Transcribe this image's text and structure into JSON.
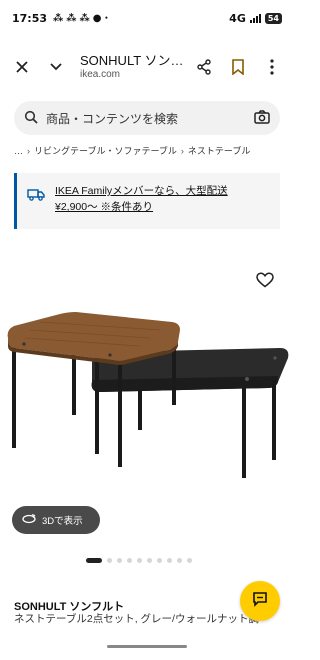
{
  "status_bar": {
    "time": "17:53",
    "network": "4G",
    "battery": "54"
  },
  "browser": {
    "page_title": "SONHULT ソン…",
    "url": "ikea.com"
  },
  "search": {
    "placeholder": "商品・コンテンツを検索"
  },
  "breadcrumb": {
    "ellipsis": "…",
    "items": [
      "リビングテーブル・ソファテーブル",
      "ネストテーブル"
    ]
  },
  "banner": {
    "text": "IKEA Familyメンバーなら、大型配送 ¥2,900〜 ※条件あり",
    "accent_color": "#0058a3"
  },
  "gallery": {
    "view_3d_label": "3Dで表示",
    "image_count": 10,
    "active_index": 0
  },
  "product": {
    "name": "SONHULT ソンフルト",
    "description": "ネストテーブル2点セット, グレー/ウォールナット調"
  },
  "chat": {
    "button_color": "#ffcc00"
  }
}
